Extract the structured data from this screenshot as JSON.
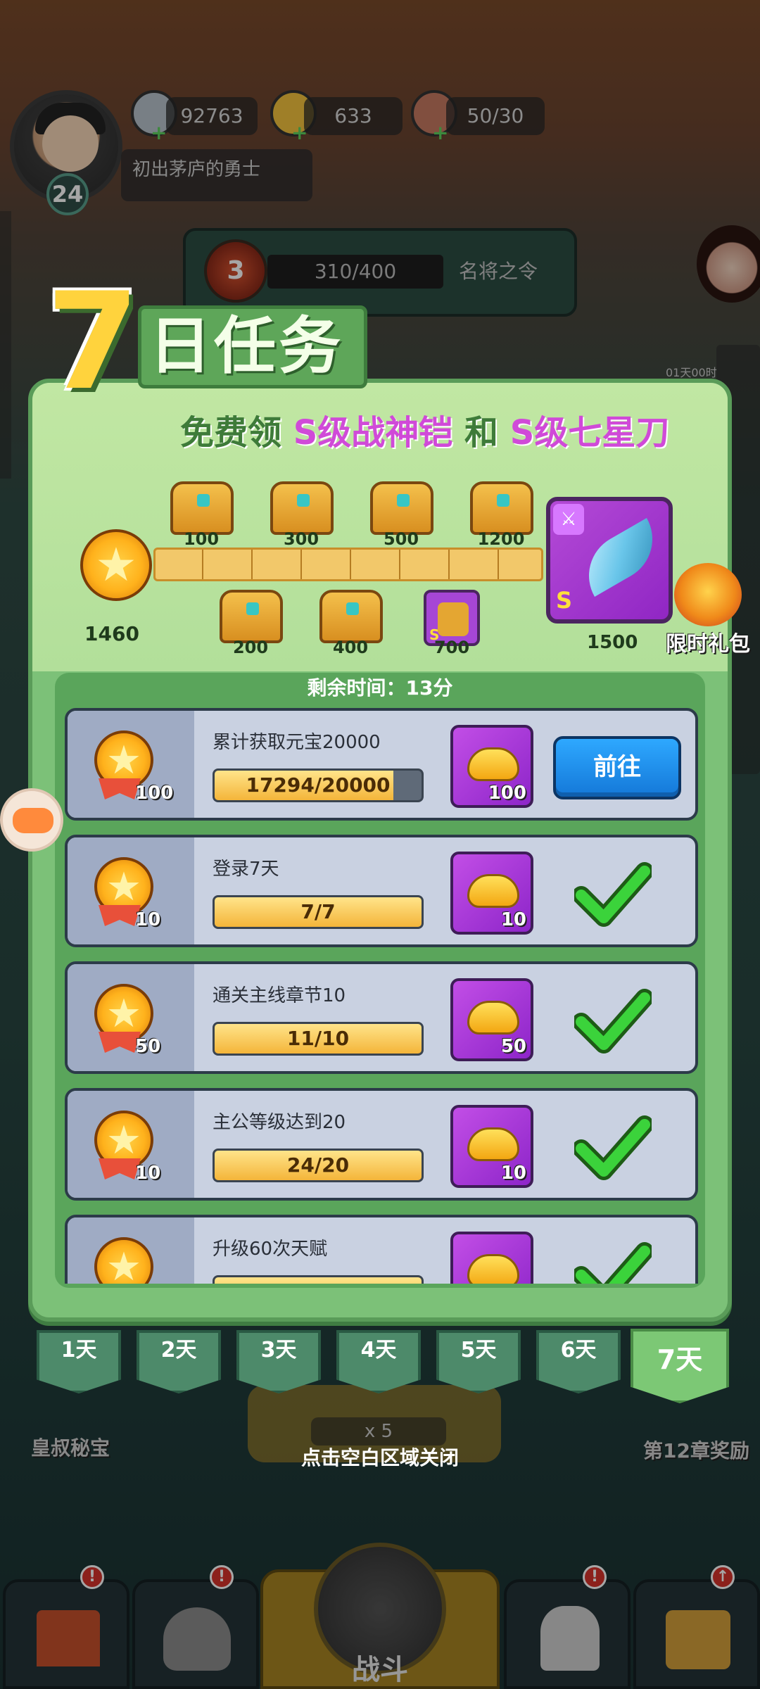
{
  "hud": {
    "level": "24",
    "silver": "92763",
    "gold": "633",
    "stamina": "50/30",
    "player_title": "初出茅庐的勇士",
    "order_rank": "3",
    "order_progress": "310/400",
    "order_name": "名将之令",
    "side_timer": "01天00时"
  },
  "modal": {
    "headline_number": "7",
    "headline_text": "日任务",
    "promo": {
      "prefix": "免费领",
      "item1": "S级战神铠",
      "joiner": "和",
      "item2": "S级七星刀"
    },
    "progress": {
      "current_score": "1460",
      "top_chests": [
        "100",
        "300",
        "500",
        "1200"
      ],
      "bottom_chests": [
        "200",
        "400"
      ],
      "bottom_armor": "700",
      "final_reward": "1500",
      "final_reward_grade": "S",
      "armor_grade": "S"
    },
    "gift_label": "限时礼包",
    "remaining_time": "剩余时间：13分",
    "tasks": [
      {
        "points": "100",
        "title": "累计获取元宝20000",
        "progress": "17294/20000",
        "progress_fraction": 0.865,
        "reward_amount": "100",
        "status": "go",
        "go_label": "前往"
      },
      {
        "points": "10",
        "title": "登录7天",
        "progress": "7/7",
        "progress_fraction": 1.0,
        "reward_amount": "10",
        "status": "done"
      },
      {
        "points": "50",
        "title": "通关主线章节10",
        "progress": "11/10",
        "progress_fraction": 1.0,
        "reward_amount": "50",
        "status": "done"
      },
      {
        "points": "10",
        "title": "主公等级达到20",
        "progress": "24/20",
        "progress_fraction": 1.0,
        "reward_amount": "10",
        "status": "done"
      },
      {
        "points": "",
        "title": "升级60次天赋",
        "progress": "",
        "progress_fraction": 1.0,
        "reward_amount": "",
        "status": "done"
      }
    ],
    "day_tabs": [
      "1天",
      "2天",
      "3天",
      "4天",
      "5天",
      "6天",
      "7天"
    ],
    "active_day": "7天",
    "close_hint": "点击空白区域关闭"
  },
  "background": {
    "left_label": "皇叔秘宝",
    "right_label": "第12章奖励",
    "stamina_cost": "x 5",
    "battle_label": "战斗"
  },
  "colors": {
    "modal_green": "#7cc178",
    "promo_purple": "#d04ad8",
    "go_button_blue": "#1f8ef0",
    "reward_purple": "#a646d6",
    "check_green": "#3bd33b"
  }
}
